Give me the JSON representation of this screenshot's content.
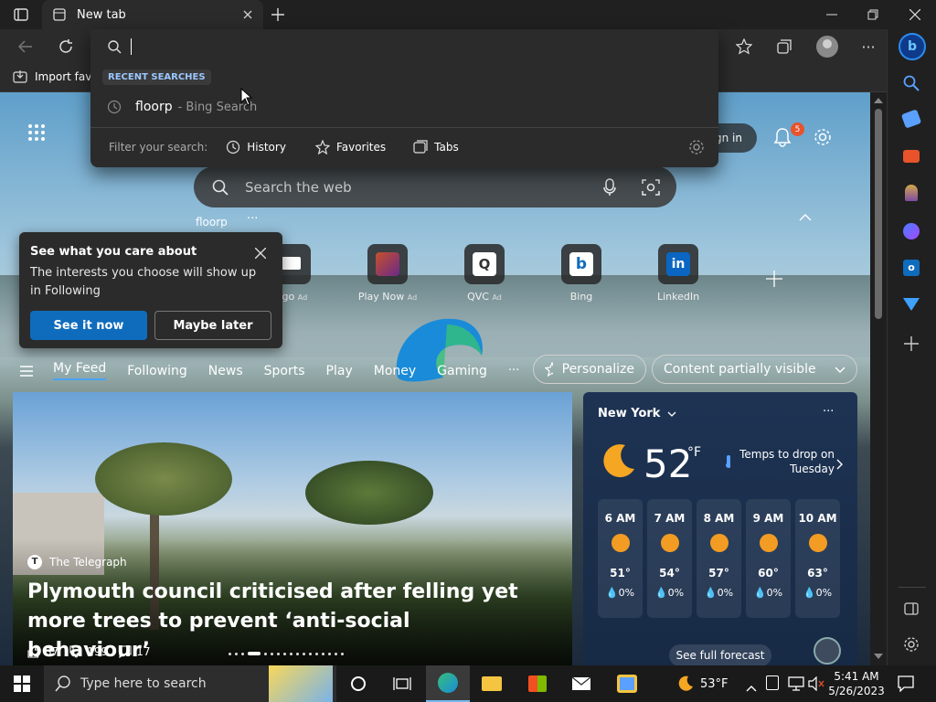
{
  "tab": {
    "title": "New tab"
  },
  "favbar": {
    "import_label": "Import favo"
  },
  "omnibox": {
    "recent_label": "RECENT SEARCHES",
    "recent_item": "floorp",
    "recent_source": "- Bing Search",
    "filter_label": "Filter your search:",
    "filters": [
      "History",
      "Favorites",
      "Tabs"
    ]
  },
  "page": {
    "signin_label": "gn in",
    "notification_count": "5",
    "search_placeholder": "Search the web",
    "recent_query": "floorp",
    "tiles": [
      {
        "label": "ago",
        "ad": "Ad"
      },
      {
        "label": "Play Now",
        "ad": "Ad"
      },
      {
        "label": "QVC",
        "ad": "Ad"
      },
      {
        "label": "Bing",
        "ad": ""
      },
      {
        "label": "LinkedIn",
        "ad": ""
      }
    ],
    "popup": {
      "title": "See what you care about",
      "body": "The interests you choose will show up in Following",
      "primary": "See it now",
      "secondary": "Maybe later"
    },
    "nav": [
      "My Feed",
      "Following",
      "News",
      "Sports",
      "Play",
      "Money",
      "Gaming"
    ],
    "personalize": "Personalize",
    "visibility": "Content partially visible",
    "article": {
      "source": "The Telegraph",
      "headline": "Plymouth council criticised after felling yet more trees to prevent ‘anti-social behaviour’",
      "likes": "37",
      "dislikes": "199",
      "comments": "17"
    },
    "weather": {
      "city": "New York",
      "temp": "52",
      "unit": "°F",
      "note": "Temps to drop on Tuesday",
      "hours": [
        {
          "time": "6 AM",
          "temp": "51°",
          "precip": "0%"
        },
        {
          "time": "7 AM",
          "temp": "54°",
          "precip": "0%"
        },
        {
          "time": "8 AM",
          "temp": "57°",
          "precip": "0%"
        },
        {
          "time": "9 AM",
          "temp": "60°",
          "precip": "0%"
        },
        {
          "time": "10 AM",
          "temp": "63°",
          "precip": "0%"
        }
      ],
      "forecast_link": "See full forecast"
    }
  },
  "taskbar": {
    "search_placeholder": "Type here to search",
    "weather": "53°F",
    "time": "5:41 AM",
    "date": "5/26/2023"
  },
  "colors": {
    "accent": "#0f6cbd",
    "badge": "#e8532c",
    "sun": "#f39c23"
  }
}
